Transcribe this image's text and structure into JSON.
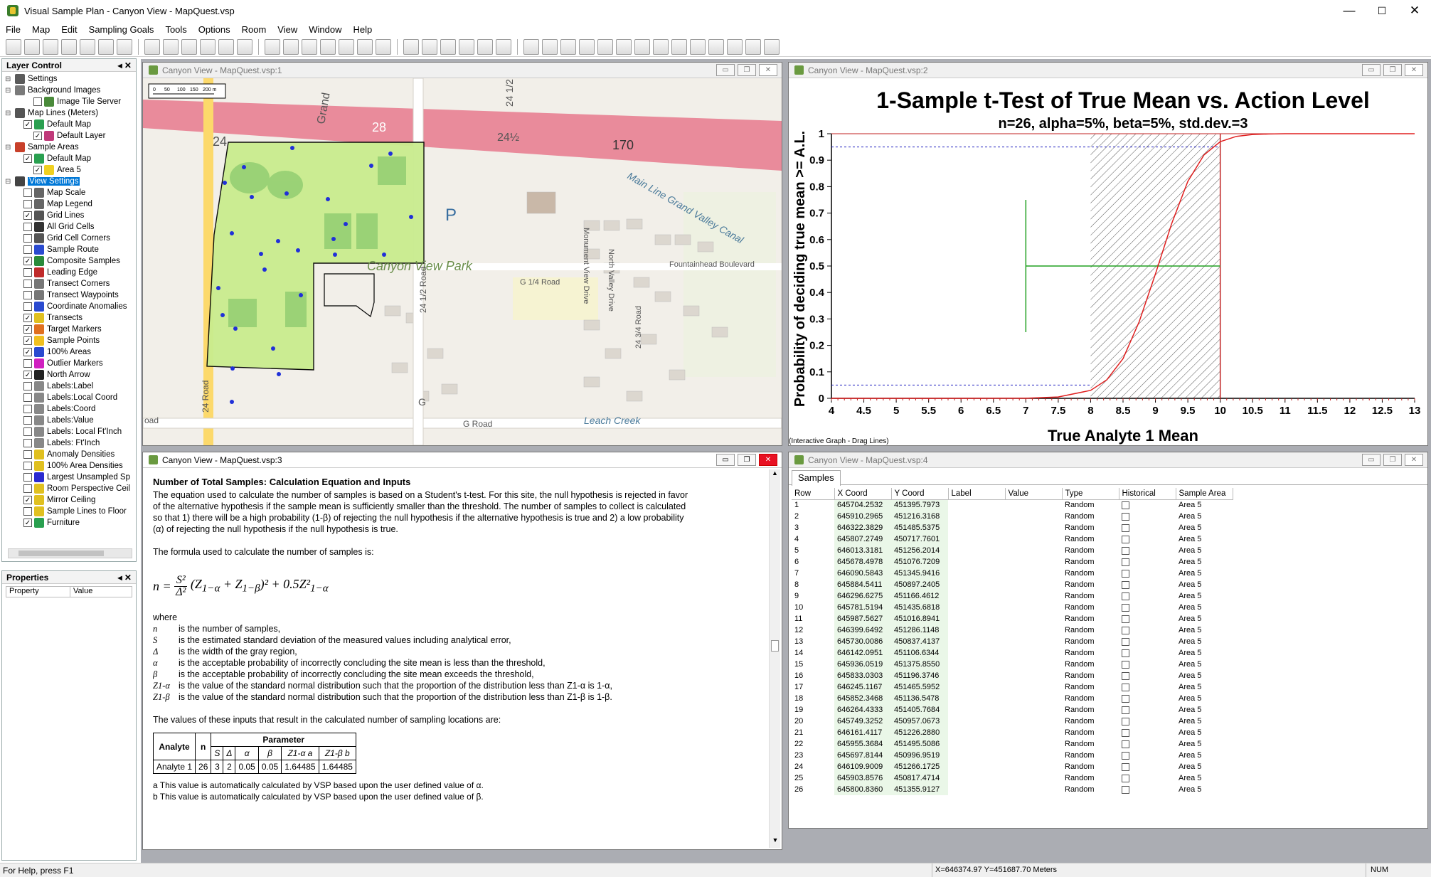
{
  "app": {
    "title": "Visual Sample Plan - Canyon View - MapQuest.vsp",
    "minimize": "—",
    "maximize": "☐",
    "close": "✕"
  },
  "menu": [
    "File",
    "Map",
    "Edit",
    "Sampling Goals",
    "Tools",
    "Options",
    "Room",
    "View",
    "Window",
    "Help"
  ],
  "layer_control": {
    "title": "Layer Control",
    "tree": [
      {
        "label": "Settings",
        "level": 0,
        "check": null,
        "icon": "#5a5a5a"
      },
      {
        "label": "Background Images",
        "level": 0,
        "check": null,
        "icon": "#7a7a7a"
      },
      {
        "label": "Image Tile Server",
        "level": 2,
        "check": false,
        "icon": "#4a8a3a"
      },
      {
        "label": "Map Lines (Meters)",
        "level": 0,
        "check": null,
        "icon": "#555555"
      },
      {
        "label": "Default Map",
        "level": 1,
        "check": true,
        "icon": "#2aa050"
      },
      {
        "label": "Default Layer",
        "level": 2,
        "check": true,
        "icon": "#c03a7a"
      },
      {
        "label": "Sample Areas",
        "level": 0,
        "check": null,
        "icon": "#c8402a"
      },
      {
        "label": "Default Map",
        "level": 1,
        "check": true,
        "icon": "#2aa050"
      },
      {
        "label": "Area 5",
        "level": 2,
        "check": true,
        "icon": "#f0d020"
      },
      {
        "label": "View Settings",
        "level": 0,
        "check": null,
        "icon": "#444444",
        "selected": true
      },
      {
        "label": "Map Scale",
        "level": 1,
        "check": false,
        "icon": "#666666"
      },
      {
        "label": "Map Legend",
        "level": 1,
        "check": false,
        "icon": "#666666"
      },
      {
        "label": "Grid Lines",
        "level": 1,
        "check": true,
        "icon": "#555555"
      },
      {
        "label": "All Grid Cells",
        "level": 1,
        "check": false,
        "icon": "#333333"
      },
      {
        "label": "Grid Cell Corners",
        "level": 1,
        "check": false,
        "icon": "#555555"
      },
      {
        "label": "Sample Route",
        "level": 1,
        "check": false,
        "icon": "#2a4ad0"
      },
      {
        "label": "Composite Samples",
        "level": 1,
        "check": true,
        "icon": "#2a8a3a"
      },
      {
        "label": "Leading Edge",
        "level": 1,
        "check": false,
        "icon": "#c02a2a"
      },
      {
        "label": "Transect Corners",
        "level": 1,
        "check": false,
        "icon": "#777777"
      },
      {
        "label": "Transect Waypoints",
        "level": 1,
        "check": false,
        "icon": "#777777"
      },
      {
        "label": "Coordinate Anomalies",
        "level": 1,
        "check": false,
        "icon": "#2a4ad0"
      },
      {
        "label": "Transects",
        "level": 1,
        "check": true,
        "icon": "#e0c020"
      },
      {
        "label": "Target Markers",
        "level": 1,
        "check": true,
        "icon": "#e07020"
      },
      {
        "label": "Sample Points",
        "level": 1,
        "check": true,
        "icon": "#f0c020"
      },
      {
        "label": "100% Areas",
        "level": 1,
        "check": true,
        "icon": "#2a4ad0"
      },
      {
        "label": "Outlier Markers",
        "level": 1,
        "check": false,
        "icon": "#d020c0"
      },
      {
        "label": "North Arrow",
        "level": 1,
        "check": true,
        "icon": "#222222"
      },
      {
        "label": "Labels:Label",
        "level": 1,
        "check": false,
        "icon": "#888888"
      },
      {
        "label": "Labels:Local Coord",
        "level": 1,
        "check": false,
        "icon": "#888888"
      },
      {
        "label": "Labels:Coord",
        "level": 1,
        "check": false,
        "icon": "#888888"
      },
      {
        "label": "Labels:Value",
        "level": 1,
        "check": false,
        "icon": "#888888"
      },
      {
        "label": "Labels: Local Ft'Inch",
        "level": 1,
        "check": false,
        "icon": "#888888"
      },
      {
        "label": "Labels: Ft'Inch",
        "level": 1,
        "check": false,
        "icon": "#888888"
      },
      {
        "label": "Anomaly Densities",
        "level": 1,
        "check": false,
        "icon": "#e0c020"
      },
      {
        "label": "100% Area Densities",
        "level": 1,
        "check": false,
        "icon": "#e0c020"
      },
      {
        "label": "Largest Unsampled Sp",
        "level": 1,
        "check": false,
        "icon": "#2a2ad0"
      },
      {
        "label": "Room Perspective Ceil",
        "level": 1,
        "check": false,
        "icon": "#e0c020"
      },
      {
        "label": "Mirror Ceiling",
        "level": 1,
        "check": true,
        "icon": "#e0c020"
      },
      {
        "label": "Sample Lines to Floor",
        "level": 1,
        "check": false,
        "icon": "#e0c020"
      },
      {
        "label": "Furniture",
        "level": 1,
        "check": true,
        "icon": "#2aa050"
      }
    ]
  },
  "properties": {
    "title": "Properties",
    "col_property": "Property",
    "col_value": "Value"
  },
  "map_window": {
    "title": "Canyon View - MapQuest.vsp:1",
    "scale": [
      "0",
      "50",
      "100",
      "150",
      "200 m"
    ],
    "labels": {
      "grand": "Grand",
      "r24": "24",
      "r28": "28",
      "r24half_a": "24½",
      "r170": "170",
      "r2412": "24 1/2",
      "park": "Canyon View Park",
      "p": "P",
      "mainline": "Main Line Grand Valley Canal",
      "monument": "Monument View Drive",
      "northvalley": "North Valley Drive",
      "fountainhead": "Fountainhead Boulevard",
      "g14": "G 1/4 Road",
      "r2412road": "24 1/2 Road",
      "r24road": "24 Road",
      "r2434": "24 3/4 Road",
      "groad": "G Road",
      "leach": "Leach Creek",
      "oad": "oad",
      "g": "G"
    }
  },
  "graph_window": {
    "title": "Canyon View - MapQuest.vsp:2",
    "note": "(Interactive Graph - Drag Lines)"
  },
  "chart_data": {
    "type": "line",
    "title": "1-Sample t-Test of True Mean vs. Action Level",
    "subtitle": "n=26, alpha=5%, beta=5%, std.dev.=3",
    "xlabel": "True Analyte 1 Mean",
    "ylabel": "Probability of deciding true mean >= A.L.",
    "xlim": [
      4,
      13
    ],
    "ylim": [
      0,
      1
    ],
    "xticks": [
      "4",
      "4.5",
      "5",
      "5.5",
      "6",
      "6.5",
      "7",
      "7.5",
      "8",
      "8.5",
      "9",
      "9.5",
      "10",
      "10.5",
      "11",
      "11.5",
      "12",
      "12.5",
      "13"
    ],
    "yticks": [
      "0",
      "0.1",
      "0.2",
      "0.3",
      "0.4",
      "0.5",
      "0.6",
      "0.7",
      "0.8",
      "0.9",
      "1"
    ],
    "action_level": 10,
    "gray_region": [
      8,
      10
    ],
    "alpha_line": 0.95,
    "beta_line": 0.05,
    "cross_x": 7,
    "cross_y": 0.5,
    "cross_vertical": [
      0.25,
      0.75
    ],
    "cross_horizontal": [
      7,
      10
    ],
    "series": [
      {
        "x": [
          4,
          5,
          6,
          7,
          7.5,
          8,
          8.25,
          8.5,
          8.75,
          9,
          9.25,
          9.5,
          9.75,
          10,
          10.25,
          10.5,
          10.75,
          11,
          11.5,
          12,
          13
        ],
        "values": [
          0,
          0,
          0,
          0.0005,
          0.005,
          0.03,
          0.07,
          0.15,
          0.29,
          0.47,
          0.66,
          0.82,
          0.92,
          0.97,
          0.99,
          0.997,
          0.999,
          1,
          1,
          1,
          1
        ]
      }
    ]
  },
  "report_window": {
    "title": "Canyon View - MapQuest.vsp:3",
    "heading": "Number of Total Samples:  Calculation Equation and Inputs",
    "para1": "The equation used to calculate the number of samples is based on a Student's t-test.  For this site, the null hypothesis is rejected in favor of the alternative hypothesis if the sample mean is sufficiently smaller than the threshold.  The number of samples to collect is calculated so that 1) there will be a high probability (1-β) of rejecting the null hypothesis if the alternative hypothesis is true and 2) a low probability (α) of rejecting the null hypothesis if the null hypothesis is true.",
    "para2": "The formula used to calculate the number of samples is:",
    "where": "where",
    "vars": [
      {
        "sym": "n",
        "desc": "is the number of samples,"
      },
      {
        "sym": "S",
        "desc": "is the estimated standard deviation of the measured values including analytical error,"
      },
      {
        "sym": "Δ",
        "desc": "is the width of the gray region,"
      },
      {
        "sym": "α",
        "desc": "is the acceptable probability of incorrectly concluding the site mean is less than the threshold,"
      },
      {
        "sym": "β",
        "desc": "is the acceptable probability of incorrectly concluding the site mean exceeds the threshold,"
      },
      {
        "sym": "Z1-α",
        "desc": "is the value of the standard normal distribution such that the proportion of the distribution less than Z1-α is 1-α,"
      },
      {
        "sym": "Z1-β",
        "desc": "is the value of the standard normal distribution such that the proportion of the distribution less than Z1-β is 1-β."
      }
    ],
    "para3": "The values of these inputs that result in the calculated number of sampling locations are:",
    "table": {
      "analyte_h": "Analyte",
      "n_h": "n",
      "param_h": "Parameter",
      "cols": [
        "S",
        "Δ",
        "α",
        "β",
        "Z1-α a",
        "Z1-β b"
      ],
      "row": [
        "Analyte 1",
        "26",
        "3",
        "2",
        "0.05",
        "0.05",
        "1.64485",
        "1.64485"
      ]
    },
    "fn_a": "a This value is automatically calculated by VSP based upon the user defined value of α.",
    "fn_b": "b This value is automatically calculated by VSP based upon the user defined value of β."
  },
  "samples_window": {
    "title": "Canyon View - MapQuest.vsp:4",
    "tab": "Samples",
    "columns": [
      "Row",
      "X Coord",
      "Y Coord",
      "Label",
      "Value",
      "Type",
      "Historical",
      "Sample Area"
    ],
    "rows": [
      [
        "1",
        "645704.2532",
        "451395.7973",
        "Random",
        "Area 5"
      ],
      [
        "2",
        "645910.2965",
        "451216.3168",
        "Random",
        "Area 5"
      ],
      [
        "3",
        "646322.3829",
        "451485.5375",
        "Random",
        "Area 5"
      ],
      [
        "4",
        "645807.2749",
        "450717.7601",
        "Random",
        "Area 5"
      ],
      [
        "5",
        "646013.3181",
        "451256.2014",
        "Random",
        "Area 5"
      ],
      [
        "6",
        "645678.4978",
        "451076.7209",
        "Random",
        "Area 5"
      ],
      [
        "7",
        "646090.5843",
        "451345.9416",
        "Random",
        "Area 5"
      ],
      [
        "8",
        "645884.5411",
        "450897.2405",
        "Random",
        "Area 5"
      ],
      [
        "9",
        "646296.6275",
        "451166.4612",
        "Random",
        "Area 5"
      ],
      [
        "10",
        "645781.5194",
        "451435.6818",
        "Random",
        "Area 5"
      ],
      [
        "11",
        "645987.5627",
        "451016.8941",
        "Random",
        "Area 5"
      ],
      [
        "12",
        "646399.6492",
        "451286.1148",
        "Random",
        "Area 5"
      ],
      [
        "13",
        "645730.0086",
        "450837.4137",
        "Random",
        "Area 5"
      ],
      [
        "14",
        "646142.0951",
        "451106.6344",
        "Random",
        "Area 5"
      ],
      [
        "15",
        "645936.0519",
        "451375.8550",
        "Random",
        "Area 5"
      ],
      [
        "16",
        "645833.0303",
        "451196.3746",
        "Random",
        "Area 5"
      ],
      [
        "17",
        "646245.1167",
        "451465.5952",
        "Random",
        "Area 5"
      ],
      [
        "18",
        "645852.3468",
        "451136.5478",
        "Random",
        "Area 5"
      ],
      [
        "19",
        "646264.4333",
        "451405.7684",
        "Random",
        "Area 5"
      ],
      [
        "20",
        "645749.3252",
        "450957.0673",
        "Random",
        "Area 5"
      ],
      [
        "21",
        "646161.4117",
        "451226.2880",
        "Random",
        "Area 5"
      ],
      [
        "22",
        "645955.3684",
        "451495.5086",
        "Random",
        "Area 5"
      ],
      [
        "23",
        "645697.8144",
        "450996.9519",
        "Random",
        "Area 5"
      ],
      [
        "24",
        "646109.9009",
        "451266.1725",
        "Random",
        "Area 5"
      ],
      [
        "25",
        "645903.8576",
        "450817.4714",
        "Random",
        "Area 5"
      ],
      [
        "26",
        "645800.8360",
        "451355.9127",
        "Random",
        "Area 5"
      ]
    ]
  },
  "status": {
    "help": "For Help, press F1",
    "coords": "X=646374.97 Y=451687.70 Meters",
    "num": "NUM"
  }
}
